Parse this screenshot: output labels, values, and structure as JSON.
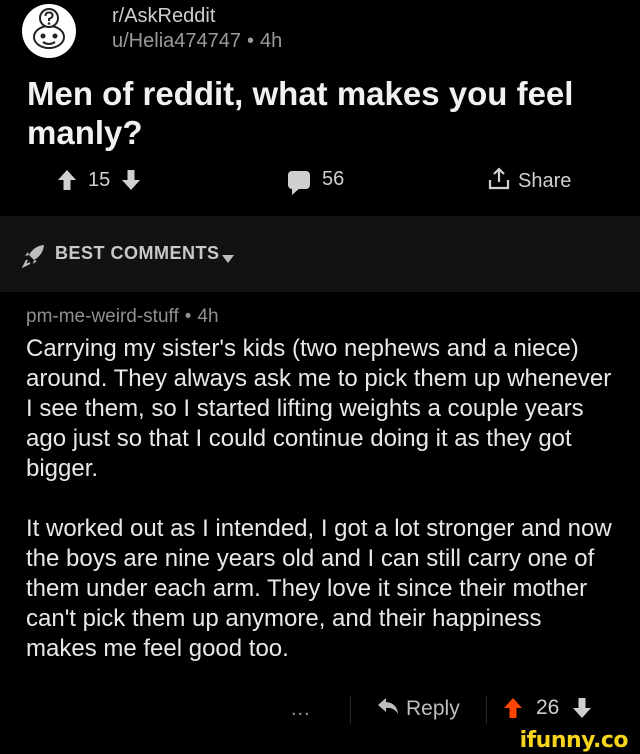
{
  "post": {
    "subreddit": "r/AskReddit",
    "author": "u/Helia474747",
    "age": "4h",
    "title": "Men of reddit, what makes you feel manly?",
    "score": "15",
    "comment_count": "56",
    "share_label": "Share"
  },
  "sort": {
    "label": "BEST COMMENTS"
  },
  "comment": {
    "author": "pm-me-weird-stuff",
    "age": "4h",
    "paragraphs": [
      "Carrying my sister's kids (two nephews and a niece) around. They always ask me to pick them up whenever I see them, so I started lifting weights a couple years ago just so that I could continue doing it as they got bigger.",
      "It worked out as I intended, I got a lot stronger and now the boys are nine years old and I can still carry one of them under each arm. They love it since their mother can't pick them up anymore, and their happiness makes me feel good too."
    ],
    "more_label": "...",
    "reply_label": "Reply",
    "score": "26"
  },
  "colors": {
    "upvote_active": "#ff4500",
    "watermark": "#f6d41c"
  },
  "icons": {
    "subreddit": "question-mark-snoo-icon",
    "upvote": "up-arrow-icon",
    "downvote": "down-arrow-icon",
    "comments": "comment-bubble-icon",
    "share": "share-upload-icon",
    "sort": "rocket-icon",
    "sort_caret": "caret-down-icon",
    "reply": "reply-arrow-icon"
  },
  "watermark": "ifunny.co"
}
